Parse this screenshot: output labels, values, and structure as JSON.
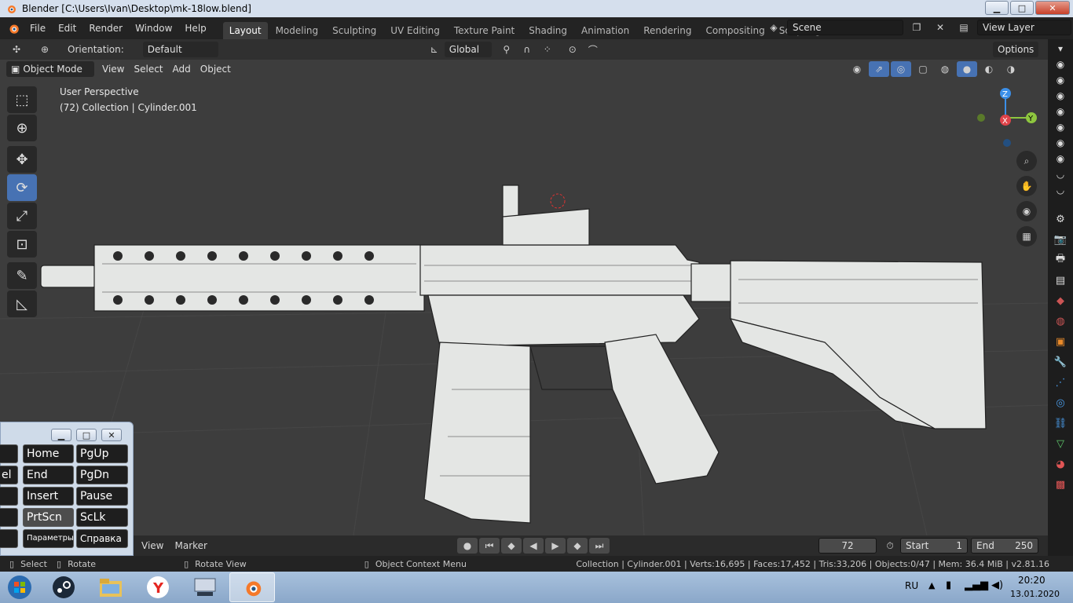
{
  "window": {
    "title": "Blender [C:\\Users\\Ivan\\Desktop\\mk-18low.blend]",
    "minimize_glyph": "▁",
    "maximize_glyph": "□",
    "close_glyph": "✕"
  },
  "menu": [
    "File",
    "Edit",
    "Render",
    "Window",
    "Help"
  ],
  "workspaces": [
    "Layout",
    "Modeling",
    "Sculpting",
    "UV Editing",
    "Texture Paint",
    "Shading",
    "Animation",
    "Rendering",
    "Compositing",
    "Scripting"
  ],
  "add_workspace": "+",
  "scene": {
    "label": "Scene"
  },
  "view_layer": {
    "label": "View Layer"
  },
  "header": {
    "orientation_label": "Orientation:",
    "orientation_value": "Default",
    "transform_orientation": "Global",
    "options_label": "Options"
  },
  "header2": {
    "mode": "Object Mode",
    "view": "View",
    "select": "Select",
    "add": "Add",
    "object": "Object"
  },
  "viewport": {
    "perspective": "User Perspective",
    "collection_info": "(72) Collection | Cylinder.001",
    "gizmo_axes": {
      "z": "Z",
      "y": "Y",
      "x": "X"
    }
  },
  "timeline": {
    "view": "View",
    "marker": "Marker",
    "current_frame": "72",
    "start_label": "Start",
    "start_value": "1",
    "end_label": "End",
    "end_value": "250"
  },
  "statusbar": {
    "select": "Select",
    "rotate": "Rotate",
    "rotate_view": "Rotate View",
    "context_menu": "Object Context Menu",
    "stats": "Collection | Cylinder.001 | Verts:16,695 | Faces:17,452 | Tris:33,206 | Objects:0/47 | Mem: 36.4 MiB | v2.81.16"
  },
  "osk": {
    "keys": [
      {
        "label": "Home"
      },
      {
        "label": "PgUp"
      },
      {
        "label": "End"
      },
      {
        "label": "PgDn"
      },
      {
        "label": "Insert"
      },
      {
        "label": "Pause"
      },
      {
        "label": "PrtScn"
      },
      {
        "label": "ScLk"
      },
      {
        "label": "Параметры"
      },
      {
        "label": "Справка"
      }
    ],
    "partial_left": "el"
  },
  "tray": {
    "lang": "RU",
    "time": "20:20",
    "date": "13.01.2020"
  },
  "colors": {
    "accent": "#4772b3",
    "axis_x": "#e0444a",
    "axis_y": "#8ec63f",
    "axis_z": "#3b8fe8"
  }
}
